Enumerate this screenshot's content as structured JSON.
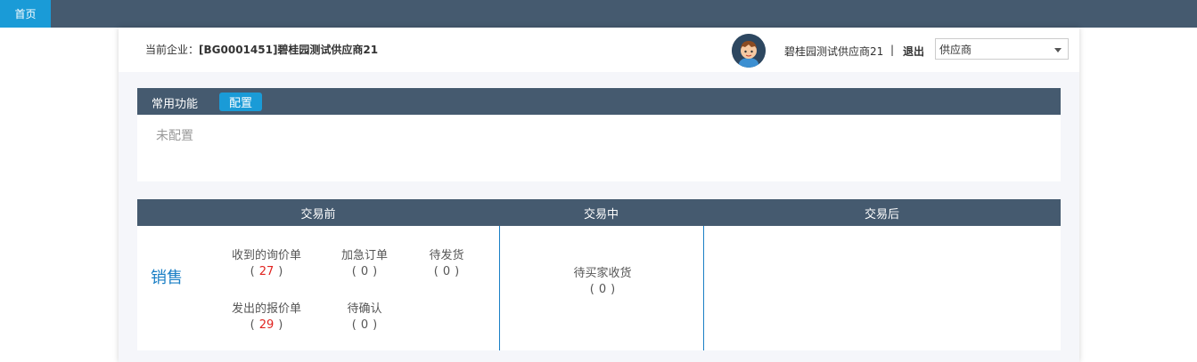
{
  "topbar": {
    "home_tab": "首页"
  },
  "header": {
    "company_label": "当前企业：",
    "company_value": "[BG0001451]碧桂园测试供应商21",
    "username": "碧桂园测试供应商21",
    "separator": "|",
    "logout": "退出",
    "role_selected": "供应商"
  },
  "common": {
    "title": "常用功能",
    "config_button": "配置",
    "empty_text": "未配置"
  },
  "trade": {
    "columns": [
      "交易前",
      "交易中",
      "交易后"
    ],
    "row_label": "销售",
    "before": [
      {
        "label": "收到的询价单",
        "value": "27",
        "highlight": true
      },
      {
        "label": "加急订单",
        "value": "0",
        "highlight": false
      },
      {
        "label": "待发货",
        "value": "0",
        "highlight": false
      },
      {
        "label": "发出的报价单",
        "value": "29",
        "highlight": true
      },
      {
        "label": "待确认",
        "value": "0",
        "highlight": false
      }
    ],
    "during": [
      {
        "label": "待买家收货",
        "value": "0",
        "highlight": false
      }
    ],
    "paren_open": "(",
    "paren_close": ")"
  },
  "colors": {
    "nav_bg": "#455a6f",
    "accent_blue": "#1a9bd7",
    "highlight_red": "#e0231f"
  }
}
